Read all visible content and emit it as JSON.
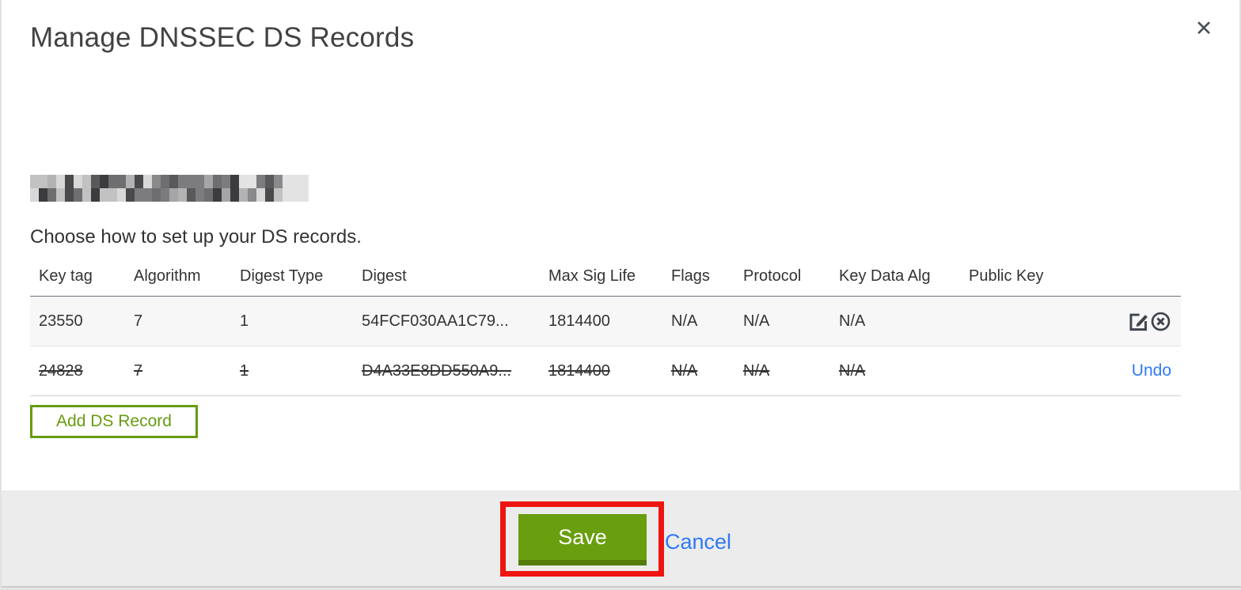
{
  "modal": {
    "title": "Manage DNSSEC DS Records",
    "close_label": "✕",
    "subtitle": "Choose how to set up your DS records.",
    "add_ds_record_label": "Add DS Record",
    "save_label": "Save",
    "cancel_label": "Cancel"
  },
  "table": {
    "columns": [
      "Key tag",
      "Algorithm",
      "Digest Type",
      "Digest",
      "Max Sig Life",
      "Flags",
      "Protocol",
      "Key Data Alg",
      "Public Key"
    ],
    "rows": [
      {
        "key_tag": "23550",
        "algorithm": "7",
        "digest_type": "1",
        "digest": "54FCF030AA1C79...",
        "max_sig_life": "1814400",
        "flags": "N/A",
        "protocol": "N/A",
        "key_data_alg": "N/A",
        "public_key": "",
        "deleted": false,
        "actions": [
          "edit",
          "delete"
        ]
      },
      {
        "key_tag": "24828",
        "algorithm": "7",
        "digest_type": "1",
        "digest": "D4A33E8DD550A9...",
        "max_sig_life": "1814400",
        "flags": "N/A",
        "protocol": "N/A",
        "key_data_alg": "N/A",
        "public_key": "",
        "deleted": true,
        "undo_label": "Undo"
      }
    ]
  },
  "colors": {
    "accent_green": "#699e0e",
    "green_dark": "#547d0a",
    "link_blue": "#2e7af7",
    "annotation_red": "#ee1511",
    "footer_gray": "#ececec"
  }
}
